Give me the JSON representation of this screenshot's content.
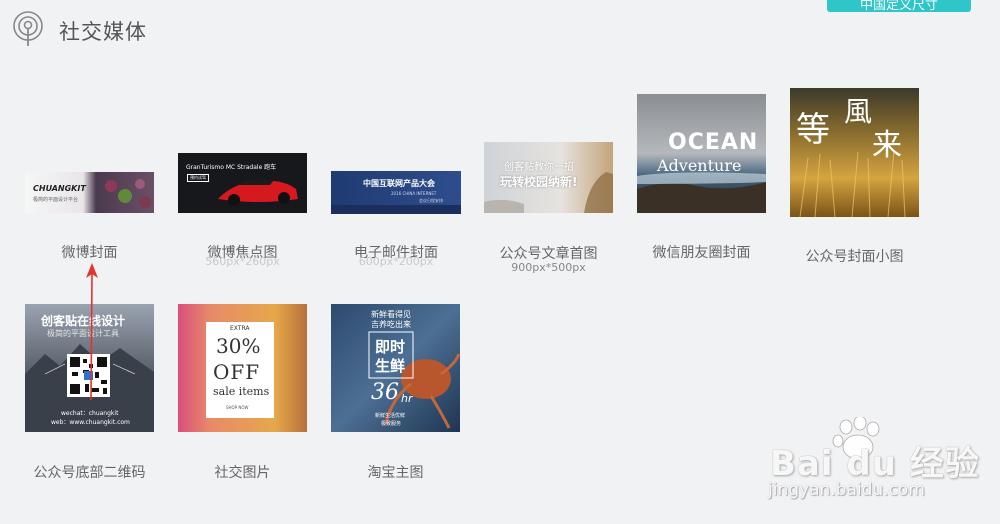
{
  "header": {
    "section_title": "社交媒体",
    "top_button_label": "中国定义尺寸"
  },
  "cards": [
    {
      "id": "weibo-cover",
      "label": "微博封面",
      "thumb_text": [
        "CHUANGKIT",
        "极简的平面设计平台"
      ]
    },
    {
      "id": "weibo-focus",
      "label": "微博焦点图",
      "sublabel_ghost": "560px*260px",
      "thumb_text": [
        "GranTurismo MC Stradale 跑车",
        "预约试驾"
      ]
    },
    {
      "id": "email-cover",
      "label": "电子邮件封面",
      "sublabel_ghost": "600px*200px",
      "thumb_text": [
        "中国互联网产品大会",
        "2016 CHINA INTERNET",
        "会议日程安排"
      ]
    },
    {
      "id": "wechat-article-cover",
      "label": "公众号文章首图",
      "sublabel": "900px*500px",
      "thumb_text": [
        "创客贴教你一招",
        "玩转校园纳新!"
      ]
    },
    {
      "id": "moments-cover",
      "label": "微信朋友圈封面",
      "thumb_text": [
        "OCEAN",
        "Adventure"
      ]
    },
    {
      "id": "wechat-small-cover",
      "label": "公众号封面小图",
      "thumb_text": [
        "等",
        "風",
        "来"
      ]
    },
    {
      "id": "wechat-qr",
      "label": "公众号底部二维码",
      "thumb_text": [
        "创客贴在线设计",
        "极简的平面设计工具",
        "wechat：chuangkit",
        "web：www.chuangkit.com"
      ]
    },
    {
      "id": "social-image",
      "label": "社交图片",
      "thumb_text": [
        "EXTRA",
        "30%",
        "OFF",
        "sale items",
        "SHOP NOW"
      ]
    },
    {
      "id": "taobao-main",
      "label": "淘宝主图",
      "thumb_text": [
        "新鲜看得见",
        "吉养吃出来",
        "即时",
        "生鲜",
        "36",
        "hr",
        "新鲜生活优鲜",
        "极致服务"
      ]
    }
  ],
  "watermark": {
    "logo_text": "Bai du 经验",
    "url": "jingyan.baidu.com"
  },
  "colors": {
    "accent": "#2fc6c9",
    "annotation_arrow": "#e5322d"
  }
}
